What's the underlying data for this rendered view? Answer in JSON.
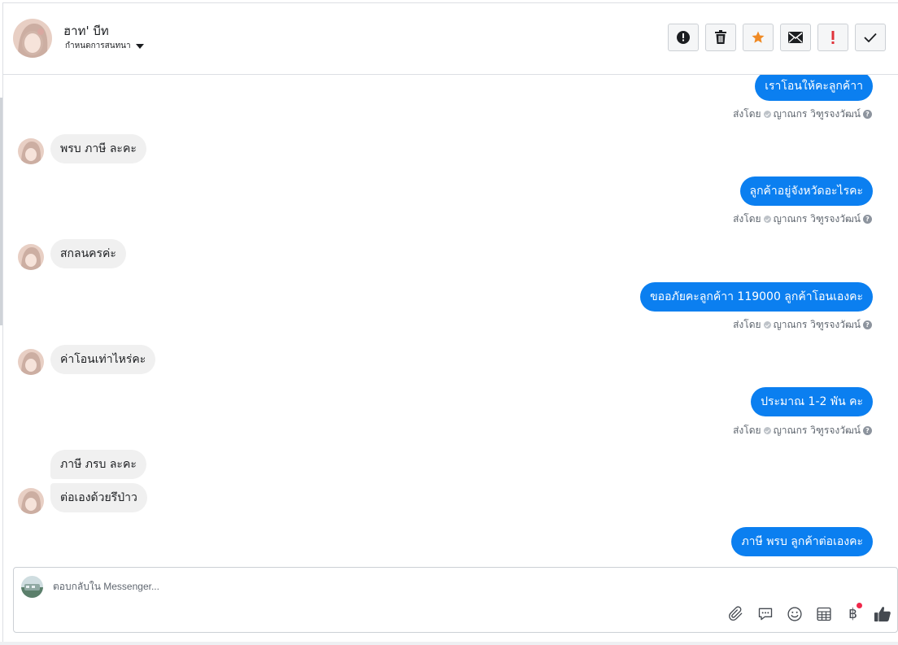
{
  "header": {
    "contact_name": "ฮาท' บีท",
    "assign_label": "กำหนดการสนทนา",
    "toolbar": [
      {
        "name": "alert-button",
        "icon": "exclamation-circle-icon"
      },
      {
        "name": "delete-button",
        "icon": "trash-icon"
      },
      {
        "name": "star-button",
        "icon": "star-icon"
      },
      {
        "name": "mark-unread-button",
        "icon": "envelope-icon"
      },
      {
        "name": "important-button",
        "icon": "exclamation-icon"
      },
      {
        "name": "done-button",
        "icon": "check-icon"
      }
    ]
  },
  "messages": [
    {
      "dir": "out",
      "text": "เราโอนให้คะลูกค้าา",
      "sent_by": "ส่งโดย",
      "agent": "ญาณกร วิฑูรจงวัฒน์"
    },
    {
      "dir": "in",
      "text": "พรบ ภาษี ละคะ"
    },
    {
      "dir": "out",
      "text": "ลูกค้าอยู่จังหวัดอะไรคะ",
      "sent_by": "ส่งโดย",
      "agent": "ญาณกร วิฑูรจงวัฒน์"
    },
    {
      "dir": "in",
      "text": "สกลนครค่ะ"
    },
    {
      "dir": "out",
      "text": "ขออภัยคะลูกค้าา 119000 ลูกค้าโอนเองคะ",
      "sent_by": "ส่งโดย",
      "agent": "ญาณกร วิฑูรจงวัฒน์"
    },
    {
      "dir": "in",
      "text": "ค่าโอนเท่าไหร่คะ"
    },
    {
      "dir": "out",
      "text": "ประมาณ 1-2 พัน คะ",
      "sent_by": "ส่งโดย",
      "agent": "ญาณกร วิฑูรจงวัฒน์"
    },
    {
      "dir": "in",
      "text": "ภาษี ภรบ ละคะ"
    },
    {
      "dir": "in",
      "text": "ต่อเองด้วยรึป่าว"
    },
    {
      "dir": "out",
      "text": "ภาษี พรบ ลูกค้าต่อเองคะ"
    }
  ],
  "composer": {
    "placeholder": "ตอบกลับใน Messenger...",
    "tools": [
      "paperclip-icon",
      "speech-bubble-icon",
      "smiley-icon",
      "table-icon",
      "baht-icon",
      "thumbs-up-icon"
    ],
    "baht_symbol": "฿",
    "colors": {
      "accent": "#0b7ff0",
      "star": "#f08a24",
      "important": "#e0333a",
      "badge": "#f0284a"
    }
  }
}
